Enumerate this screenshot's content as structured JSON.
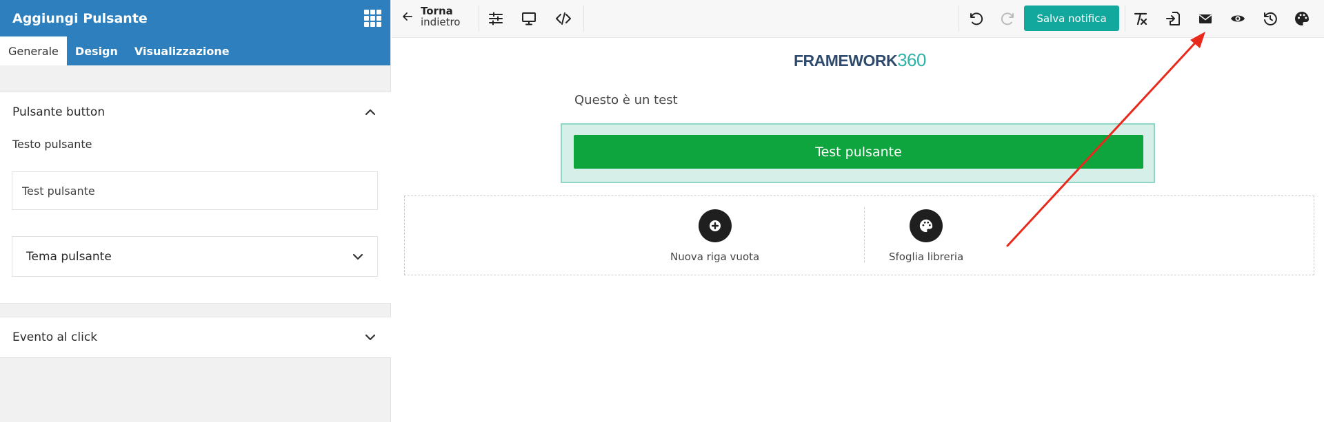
{
  "sidebar": {
    "title": "Aggiungi Pulsante",
    "tabs": [
      {
        "label": "Generale",
        "active": true
      },
      {
        "label": "Design",
        "active": false
      },
      {
        "label": "Visualizzazione",
        "active": false
      }
    ],
    "section_button": {
      "title": "Pulsante button",
      "text_label": "Testo pulsante",
      "text_value": "Test pulsante",
      "theme_title": "Tema pulsante"
    },
    "section_click": {
      "title": "Evento al click"
    }
  },
  "toolbar": {
    "back_line1": "Torna",
    "back_line2": "indietro",
    "save_label": "Salva notifica"
  },
  "canvas": {
    "logo_text": "FRAMEWORK",
    "logo_number": "360",
    "intro_text": "Questo è un test",
    "cta_label": "Test pulsante",
    "new_row_label": "Nuova riga vuota",
    "library_label": "Sfoglia libreria"
  },
  "colors": {
    "sidebar_header": "#2d7fbd",
    "save_button": "#13a89e",
    "cta_button": "#0ea53e",
    "annotation_arrow": "#e8291c"
  }
}
